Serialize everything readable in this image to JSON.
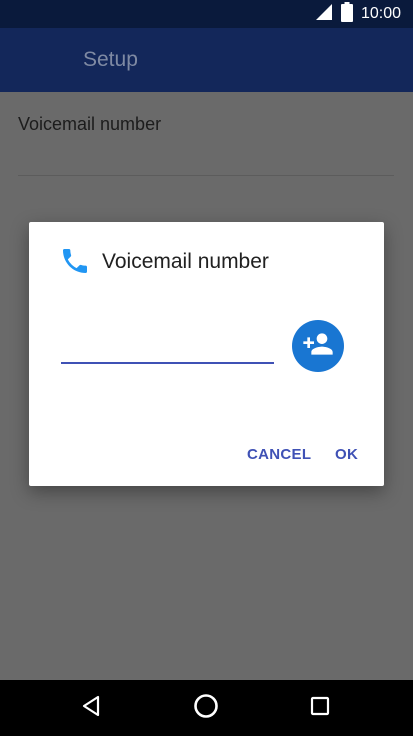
{
  "status_bar": {
    "time": "10:00",
    "icons": [
      "signal-icon",
      "battery-icon"
    ]
  },
  "app_bar": {
    "title": "Setup"
  },
  "preference": {
    "title": "Voicemail number"
  },
  "dialog": {
    "title": "Voicemail number",
    "icon": "phone-icon",
    "input_value": "",
    "contact_icon": "add-contact-icon",
    "cancel_label": "CANCEL",
    "ok_label": "OK"
  },
  "nav_bar": {
    "icons": [
      "back-icon",
      "home-icon",
      "recents-icon"
    ]
  },
  "colors": {
    "status_bar": "#0a1a3c",
    "app_bar": "#13275a",
    "scrim": "#6a6a6a",
    "accent": "#3f51b5",
    "contact_button": "#1976d2",
    "phone_icon": "#2196f3"
  }
}
